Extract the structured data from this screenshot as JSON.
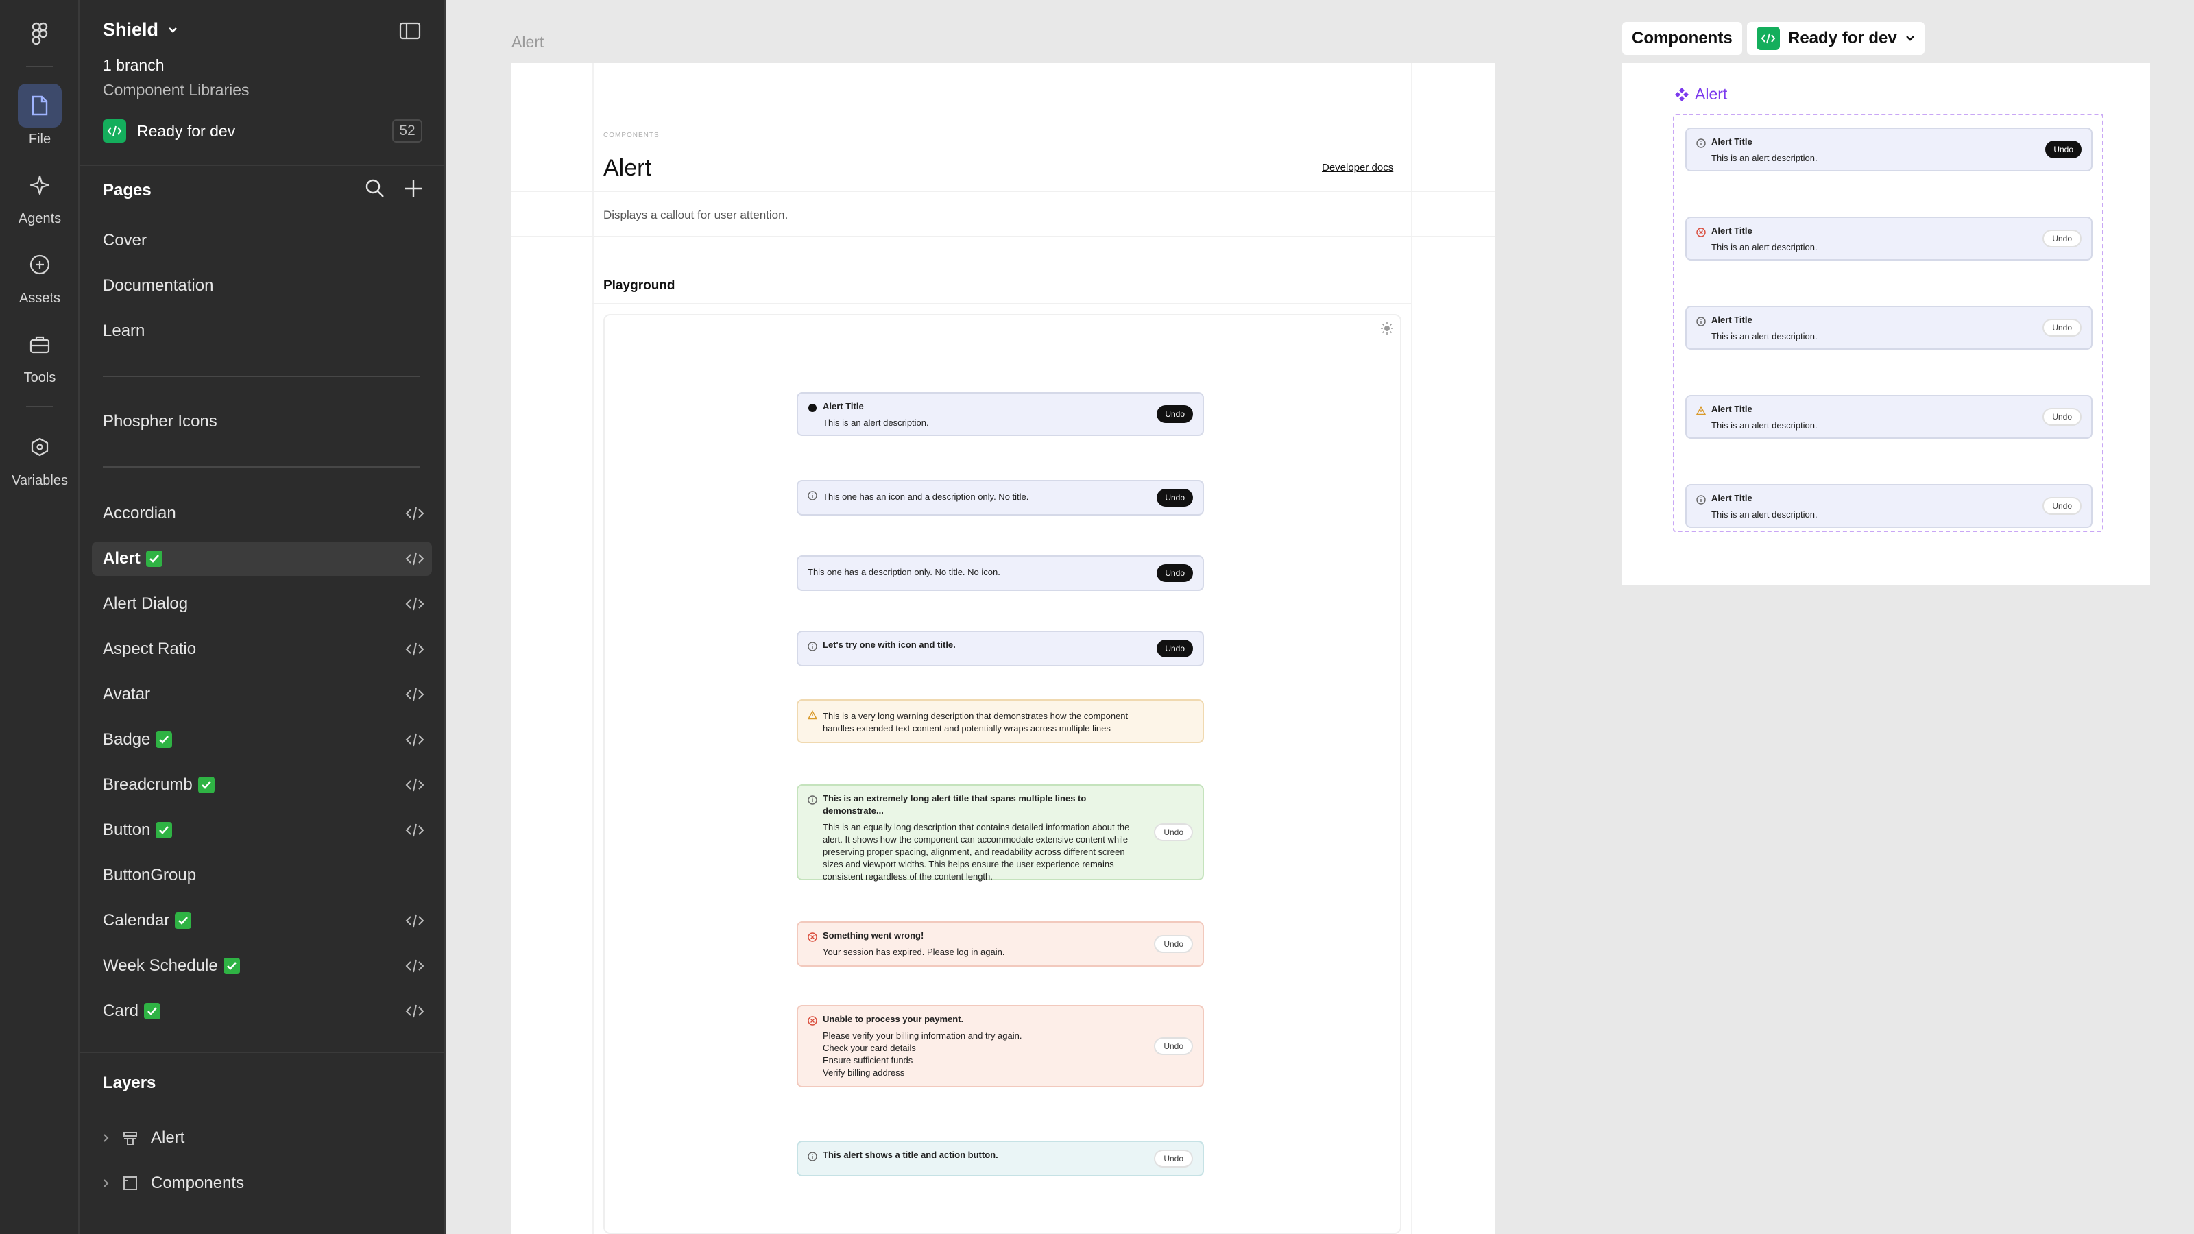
{
  "sidebar": {
    "project": "Shield",
    "branch": "1 branch",
    "team": "Component Libraries",
    "status_label": "Ready for dev",
    "status_count": "52",
    "pages_title": "Pages",
    "pages_top": [
      "Cover",
      "Documentation",
      "Learn"
    ],
    "pages_icons": [
      "Phospher Icons"
    ],
    "components": [
      {
        "label": "Accordian",
        "done": false,
        "dev": true
      },
      {
        "label": "Alert",
        "done": true,
        "dev": true,
        "selected": true
      },
      {
        "label": "Alert Dialog",
        "done": false,
        "dev": true
      },
      {
        "label": "Aspect Ratio",
        "done": false,
        "dev": true
      },
      {
        "label": "Avatar",
        "done": false,
        "dev": true
      },
      {
        "label": "Badge",
        "done": true,
        "dev": true
      },
      {
        "label": "Breadcrumb",
        "done": true,
        "dev": true
      },
      {
        "label": "Button",
        "done": true,
        "dev": true
      },
      {
        "label": "ButtonGroup",
        "done": false,
        "dev": false
      },
      {
        "label": "Calendar",
        "done": true,
        "dev": true
      },
      {
        "label": "Week Schedule",
        "done": true,
        "dev": true
      },
      {
        "label": "Card",
        "done": true,
        "dev": true
      }
    ],
    "layers_title": "Layers",
    "layers": [
      "Alert",
      "Components"
    ]
  },
  "rail": {
    "items": [
      "File",
      "Agents",
      "Assets",
      "Tools",
      "Variables"
    ]
  },
  "canvas": {
    "frame_label": "Alert",
    "kicker": "COMPONENTS",
    "title": "Alert",
    "dev_docs": "Developer docs",
    "description": "Displays a callout for user attention.",
    "playground": "Playground",
    "alerts": [
      {
        "title": "Alert Title",
        "desc": "This is an alert description.",
        "btn": "Undo",
        "btn_style": "dark",
        "variant": "default",
        "icon": "filled"
      },
      {
        "title": "",
        "desc": "This one has an icon and a description only. No title.",
        "btn": "Undo",
        "btn_style": "dark",
        "variant": "default",
        "icon": "info"
      },
      {
        "title": "",
        "desc": "This one has a description only. No title. No icon.",
        "btn": "Undo",
        "btn_style": "dark",
        "variant": "default",
        "icon": "none"
      },
      {
        "title": "Let's try one with icon and title.",
        "desc": "",
        "btn": "Undo",
        "btn_style": "dark",
        "variant": "default",
        "icon": "info"
      },
      {
        "title": "",
        "desc": "This is a very long warning description that demonstrates how the component handles extended text content and potentially wraps across multiple lines",
        "btn": "",
        "btn_style": "none",
        "variant": "warn",
        "icon": "warn"
      },
      {
        "title": "This is an extremely long alert title that spans multiple lines to demonstrate...",
        "desc": "This is an equally long description that contains detailed information about the alert. It shows how the component can accommodate extensive content while preserving proper spacing, alignment, and readability across different screen sizes and viewport widths. This helps ensure the user experience remains consistent regardless of the content length.",
        "btn": "Undo",
        "btn_style": "light",
        "variant": "ok",
        "icon": "info"
      },
      {
        "title": "Something went wrong!",
        "desc": "Your session has expired. Please log in again.",
        "btn": "Undo",
        "btn_style": "light",
        "variant": "err",
        "icon": "err"
      },
      {
        "title": "Unable to process your payment.",
        "desc": "Please verify your billing information and try again.",
        "list": [
          "Check your card details",
          "Ensure sufficient funds",
          "Verify billing address"
        ],
        "btn": "Undo",
        "btn_style": "light",
        "variant": "err",
        "icon": "err"
      },
      {
        "title": "This alert shows a title and action button.",
        "desc": "",
        "btn": "Undo",
        "btn_style": "light",
        "variant": "info",
        "icon": "info"
      }
    ]
  },
  "components_panel": {
    "tab": "Components",
    "status": "Ready for dev",
    "component_name": "Alert",
    "variants": [
      {
        "title": "Alert Title",
        "desc": "This is an alert description.",
        "btn": "Undo",
        "btn_style": "dark",
        "variant": "default"
      },
      {
        "title": "Alert Title",
        "desc": "This is an alert description.",
        "btn": "Undo",
        "btn_style": "light",
        "variant": "err"
      },
      {
        "title": "Alert Title",
        "desc": "This is an alert description.",
        "btn": "Undo",
        "btn_style": "light",
        "variant": "ok"
      },
      {
        "title": "Alert Title",
        "desc": "This is an alert description.",
        "btn": "Undo",
        "btn_style": "light",
        "variant": "warn"
      },
      {
        "title": "Alert Title",
        "desc": "This is an alert description.",
        "btn": "Undo",
        "btn_style": "light",
        "variant": "info"
      }
    ]
  },
  "colors": {
    "panel_bg": "#2c2c2c",
    "canvas_bg": "#e8e8e8",
    "accent_green": "#14ae5c",
    "component_purple": "#7c3aed"
  }
}
